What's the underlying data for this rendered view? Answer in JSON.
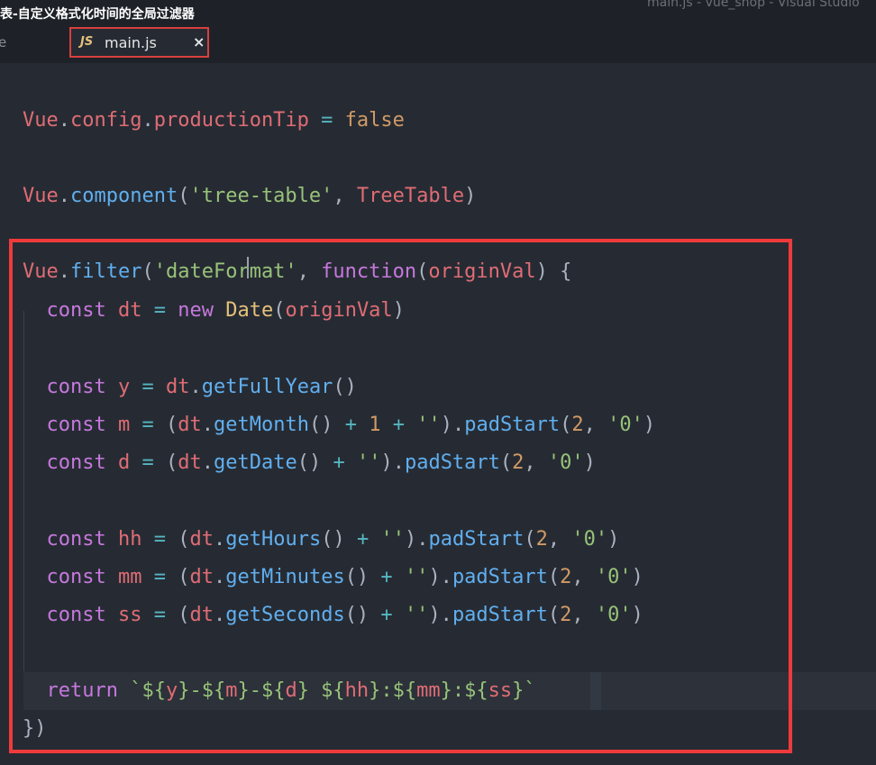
{
  "window": {
    "overlay_title": "表-自定义格式化时间的全局过滤器",
    "title": "main.js - vue_shop - Visual Studio"
  },
  "tabs": {
    "inactive_label": "e",
    "active": {
      "icon_text": "JS",
      "label": "main.js",
      "close_glyph": "×"
    }
  },
  "editor": {
    "lines": [
      [
        [
          "t-var",
          "Vue"
        ],
        [
          "t-pun",
          "."
        ],
        [
          "t-var",
          "config"
        ],
        [
          "t-pun",
          "."
        ],
        [
          "t-var",
          "productionTip"
        ],
        [
          "t-op",
          " = "
        ],
        [
          "t-num",
          "false"
        ]
      ],
      [
        [
          "t-var",
          "Vue"
        ],
        [
          "t-pun",
          "."
        ],
        [
          "t-fn",
          "component"
        ],
        [
          "t-pun",
          "("
        ],
        [
          "t-str",
          "'tree-table'"
        ],
        [
          "t-pun",
          ", "
        ],
        [
          "t-var",
          "TreeTable"
        ],
        [
          "t-pun",
          ")"
        ]
      ],
      [
        [
          "t-var",
          "Vue"
        ],
        [
          "t-pun",
          "."
        ],
        [
          "t-fn",
          "filter"
        ],
        [
          "t-pun",
          "("
        ],
        [
          "t-str",
          "'dateFormat'"
        ],
        [
          "t-pun",
          ", "
        ],
        [
          "t-key",
          "function"
        ],
        [
          "t-pun",
          "("
        ],
        [
          "t-var",
          "originVal"
        ],
        [
          "t-pun",
          ") {"
        ]
      ],
      [
        [
          "t-pun",
          "  "
        ],
        [
          "t-key",
          "const"
        ],
        [
          "t-var",
          " dt"
        ],
        [
          "t-op",
          " = "
        ],
        [
          "t-key",
          "new"
        ],
        [
          "t-pun",
          " "
        ],
        [
          "t-cls",
          "Date"
        ],
        [
          "t-pun",
          "("
        ],
        [
          "t-var",
          "originVal"
        ],
        [
          "t-pun",
          ")"
        ]
      ],
      [],
      [
        [
          "t-pun",
          "  "
        ],
        [
          "t-key",
          "const"
        ],
        [
          "t-var",
          " y"
        ],
        [
          "t-op",
          " = "
        ],
        [
          "t-var",
          "dt"
        ],
        [
          "t-pun",
          "."
        ],
        [
          "t-fn",
          "getFullYear"
        ],
        [
          "t-pun",
          "()"
        ]
      ],
      [
        [
          "t-pun",
          "  "
        ],
        [
          "t-key",
          "const"
        ],
        [
          "t-var",
          " m"
        ],
        [
          "t-op",
          " = "
        ],
        [
          "t-pun",
          "("
        ],
        [
          "t-var",
          "dt"
        ],
        [
          "t-pun",
          "."
        ],
        [
          "t-fn",
          "getMonth"
        ],
        [
          "t-pun",
          "()"
        ],
        [
          "t-op",
          " + "
        ],
        [
          "t-num",
          "1"
        ],
        [
          "t-op",
          " + "
        ],
        [
          "t-str",
          "''"
        ],
        [
          "t-pun",
          ")."
        ],
        [
          "t-fn",
          "padStart"
        ],
        [
          "t-pun",
          "("
        ],
        [
          "t-num",
          "2"
        ],
        [
          "t-pun",
          ", "
        ],
        [
          "t-str",
          "'0'"
        ],
        [
          "t-pun",
          ")"
        ]
      ],
      [
        [
          "t-pun",
          "  "
        ],
        [
          "t-key",
          "const"
        ],
        [
          "t-var",
          " d"
        ],
        [
          "t-op",
          " = "
        ],
        [
          "t-pun",
          "("
        ],
        [
          "t-var",
          "dt"
        ],
        [
          "t-pun",
          "."
        ],
        [
          "t-fn",
          "getDate"
        ],
        [
          "t-pun",
          "()"
        ],
        [
          "t-op",
          " + "
        ],
        [
          "t-str",
          "''"
        ],
        [
          "t-pun",
          ")."
        ],
        [
          "t-fn",
          "padStart"
        ],
        [
          "t-pun",
          "("
        ],
        [
          "t-num",
          "2"
        ],
        [
          "t-pun",
          ", "
        ],
        [
          "t-str",
          "'0'"
        ],
        [
          "t-pun",
          ")"
        ]
      ],
      [],
      [
        [
          "t-pun",
          "  "
        ],
        [
          "t-key",
          "const"
        ],
        [
          "t-var",
          " hh"
        ],
        [
          "t-op",
          " = "
        ],
        [
          "t-pun",
          "("
        ],
        [
          "t-var",
          "dt"
        ],
        [
          "t-pun",
          "."
        ],
        [
          "t-fn",
          "getHours"
        ],
        [
          "t-pun",
          "()"
        ],
        [
          "t-op",
          " + "
        ],
        [
          "t-str",
          "''"
        ],
        [
          "t-pun",
          ")."
        ],
        [
          "t-fn",
          "padStart"
        ],
        [
          "t-pun",
          "("
        ],
        [
          "t-num",
          "2"
        ],
        [
          "t-pun",
          ", "
        ],
        [
          "t-str",
          "'0'"
        ],
        [
          "t-pun",
          ")"
        ]
      ],
      [
        [
          "t-pun",
          "  "
        ],
        [
          "t-key",
          "const"
        ],
        [
          "t-var",
          " mm"
        ],
        [
          "t-op",
          " = "
        ],
        [
          "t-pun",
          "("
        ],
        [
          "t-var",
          "dt"
        ],
        [
          "t-pun",
          "."
        ],
        [
          "t-fn",
          "getMinutes"
        ],
        [
          "t-pun",
          "()"
        ],
        [
          "t-op",
          " + "
        ],
        [
          "t-str",
          "''"
        ],
        [
          "t-pun",
          ")."
        ],
        [
          "t-fn",
          "padStart"
        ],
        [
          "t-pun",
          "("
        ],
        [
          "t-num",
          "2"
        ],
        [
          "t-pun",
          ", "
        ],
        [
          "t-str",
          "'0'"
        ],
        [
          "t-pun",
          ")"
        ]
      ],
      [
        [
          "t-pun",
          "  "
        ],
        [
          "t-key",
          "const"
        ],
        [
          "t-var",
          " ss"
        ],
        [
          "t-op",
          " = "
        ],
        [
          "t-pun",
          "("
        ],
        [
          "t-var",
          "dt"
        ],
        [
          "t-pun",
          "."
        ],
        [
          "t-fn",
          "getSeconds"
        ],
        [
          "t-pun",
          "()"
        ],
        [
          "t-op",
          " + "
        ],
        [
          "t-str",
          "''"
        ],
        [
          "t-pun",
          ")."
        ],
        [
          "t-fn",
          "padStart"
        ],
        [
          "t-pun",
          "("
        ],
        [
          "t-num",
          "2"
        ],
        [
          "t-pun",
          ", "
        ],
        [
          "t-str",
          "'0'"
        ],
        [
          "t-pun",
          ")"
        ]
      ],
      [],
      [
        [
          "t-pun",
          "  "
        ],
        [
          "t-key",
          "return"
        ],
        [
          "t-str",
          " `${"
        ],
        [
          "t-var",
          "y"
        ],
        [
          "t-str",
          "}-${"
        ],
        [
          "t-var",
          "m"
        ],
        [
          "t-str",
          "}-${"
        ],
        [
          "t-var",
          "d"
        ],
        [
          "t-str",
          "} ${"
        ],
        [
          "t-var",
          "hh"
        ],
        [
          "t-str",
          "}:${"
        ],
        [
          "t-var",
          "mm"
        ],
        [
          "t-str",
          "}:${"
        ],
        [
          "t-var",
          "ss"
        ],
        [
          "t-str",
          "}`"
        ]
      ],
      [
        [
          "t-pun",
          "})"
        ]
      ]
    ]
  }
}
